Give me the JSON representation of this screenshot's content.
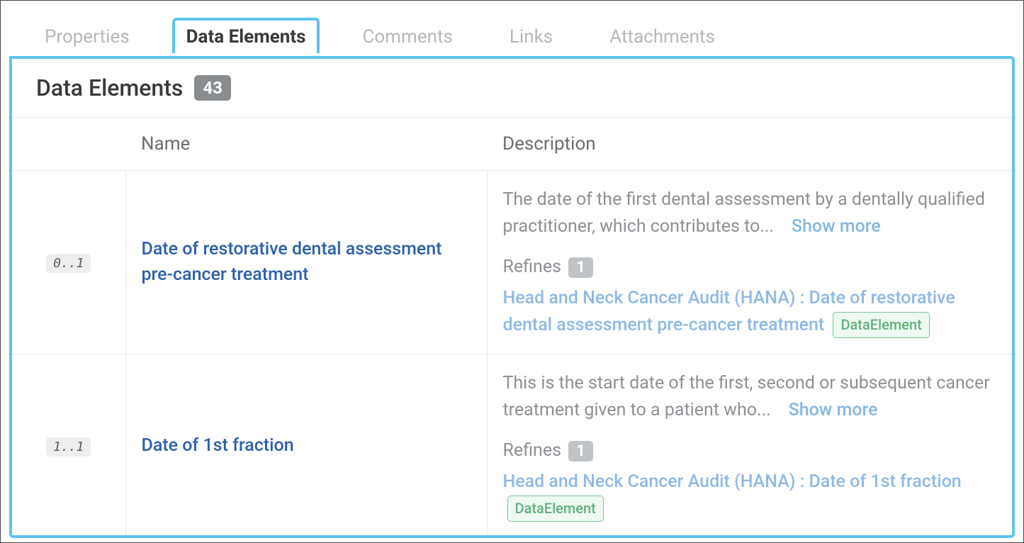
{
  "tabs": {
    "properties": "Properties",
    "data_elements": "Data Elements",
    "comments": "Comments",
    "links": "Links",
    "attachments": "Attachments"
  },
  "panel": {
    "title": "Data Elements",
    "count": "43"
  },
  "table": {
    "headers": {
      "name": "Name",
      "description": "Description"
    },
    "rows": [
      {
        "cardinality": "0..1",
        "name": "Date of restorative dental assessment pre-cancer treatment",
        "description": "The date of the first dental assessment by a dentally qualified practitioner, which contributes to...",
        "show_more": "Show more",
        "refines_label": "Refines",
        "refines_count": "1",
        "refines_link": "Head and Neck Cancer Audit (HANA) : Date of restorative dental assessment pre-cancer treatment",
        "refines_type": "DataElement"
      },
      {
        "cardinality": "1..1",
        "name": "Date of 1st fraction",
        "description": "This is the start date of the first, second or subsequent cancer treatment given to a patient who...",
        "show_more": "Show more",
        "refines_label": "Refines",
        "refines_count": "1",
        "refines_link": "Head and Neck Cancer Audit (HANA) : Date of 1st fraction",
        "refines_type": "DataElement"
      }
    ]
  }
}
